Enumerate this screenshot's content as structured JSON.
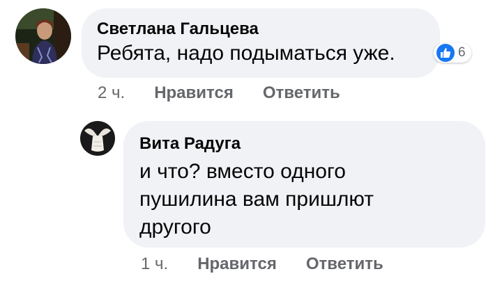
{
  "comments": [
    {
      "author": "Светлана Гальцева",
      "text": "Ребята, надо подыматься уже.",
      "time": "2 ч.",
      "like_label": "Нравится",
      "reply_label": "Ответить",
      "reaction_icon": "like-icon",
      "reaction_count": "6"
    }
  ],
  "reply": {
    "author": "Вита Радуга",
    "text": "и что? вместо одного\nпушилина вам пришлют\nдругого",
    "time": "1 ч.",
    "like_label": "Нравится",
    "reply_label": "Ответить"
  },
  "colors": {
    "bubble": "#f0f2f5",
    "text": "#050505",
    "secondary": "#65676b",
    "like_blue": "#1877f2"
  }
}
